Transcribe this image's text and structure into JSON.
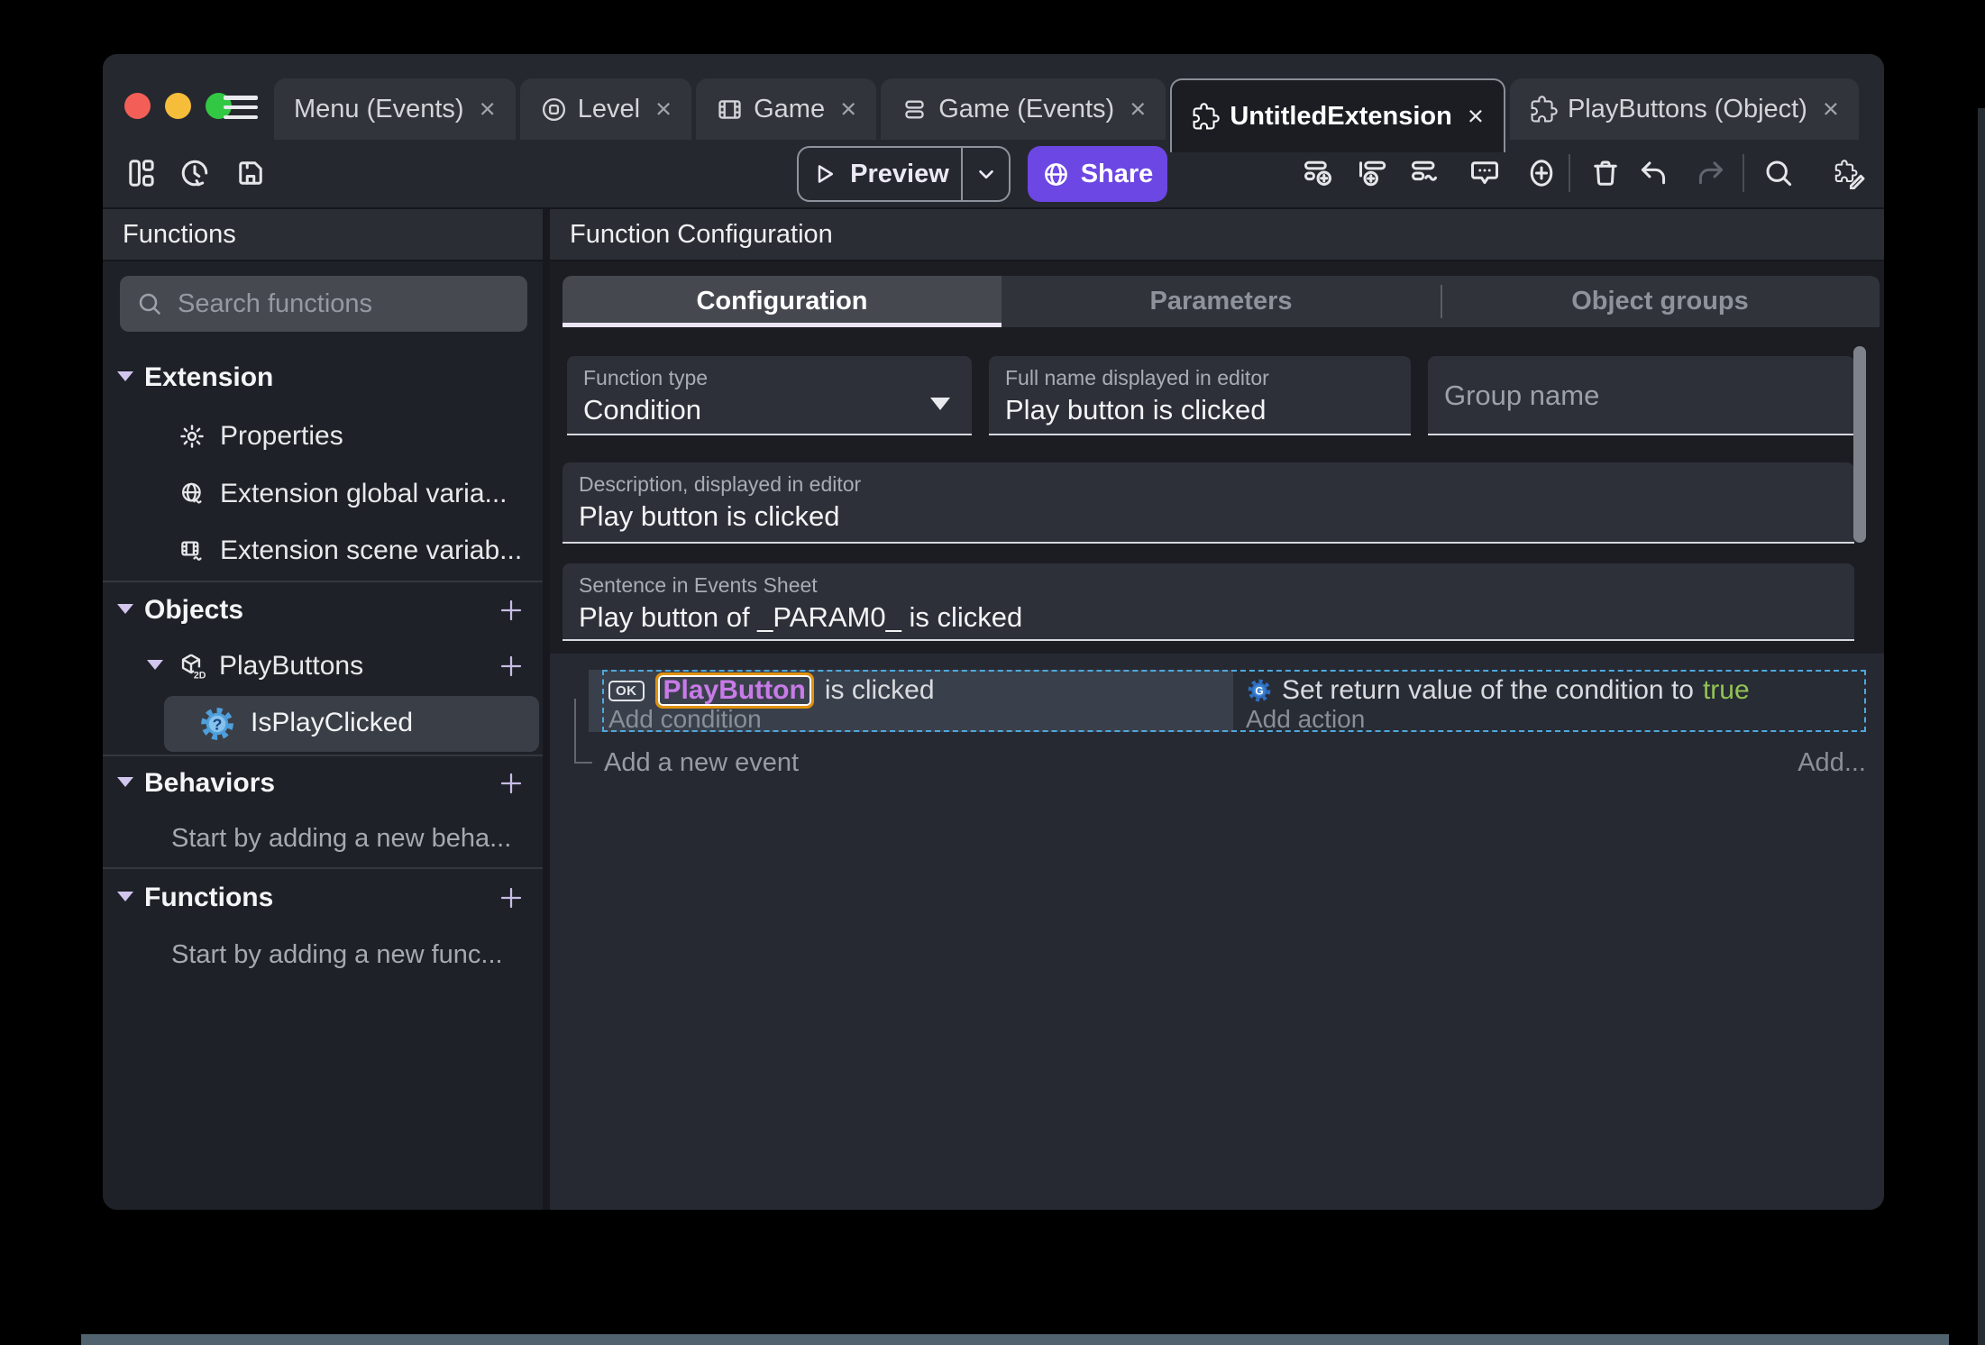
{
  "window_tabs": [
    {
      "label": "Menu (Events)",
      "close": "×"
    },
    {
      "label": "Level",
      "close": "×"
    },
    {
      "label": "Game",
      "close": "×"
    },
    {
      "label": "Game (Events)",
      "close": "×"
    },
    {
      "label": "UntitledExtension",
      "close": "×"
    },
    {
      "label": "PlayButtons (Object)",
      "close": "×"
    }
  ],
  "toolbar": {
    "preview_label": "Preview",
    "share_label": "Share"
  },
  "sidebar": {
    "title": "Functions",
    "search_placeholder": "Search functions",
    "extension_section": "Extension",
    "properties": "Properties",
    "global_vars": "Extension global varia...",
    "scene_vars": "Extension scene variab...",
    "objects_section": "Objects",
    "playbuttons": "PlayButtons",
    "selected_function": "IsPlayClicked",
    "behaviors_section": "Behaviors",
    "behaviors_empty": "Start by adding a new beha...",
    "functions_section": "Functions",
    "functions_empty": "Start by adding a new func..."
  },
  "main": {
    "title": "Function Configuration",
    "tabs": [
      "Configuration",
      "Parameters",
      "Object groups"
    ],
    "function_type_label": "Function type",
    "function_type_value": "Condition",
    "full_name_label": "Full name displayed in editor",
    "full_name_value": "Play button is clicked",
    "group_name_placeholder": "Group name",
    "description_label": "Description, displayed in editor",
    "description_value": "Play button is clicked",
    "sentence_label": "Sentence in Events Sheet",
    "sentence_value": "Play button of _PARAM0_ is clicked"
  },
  "events": {
    "condition_object_icon": "OK",
    "condition_object": "PlayButton",
    "condition_suffix": "is clicked",
    "add_condition": "Add condition",
    "action_prefix": "Set return value of the condition to",
    "action_value": "true",
    "add_action": "Add action",
    "add_new_event": "Add a new event",
    "add_more": "Add..."
  },
  "colors": {
    "accent_purple": "#6c47e3",
    "object_purple": "#c87be8",
    "selection_orange": "#e0920e",
    "true_green": "#92c353",
    "selection_dashed_blue": "#4fa8dc",
    "traffic_red": "#f35f57",
    "traffic_yellow": "#f6bd3b",
    "traffic_green": "#32c844"
  }
}
